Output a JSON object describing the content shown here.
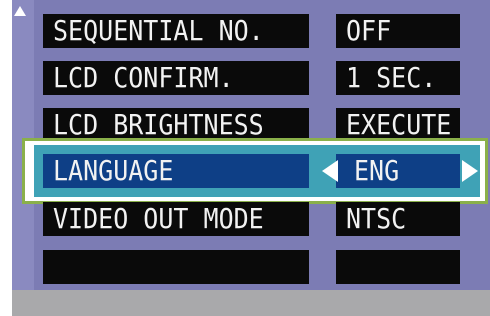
{
  "menu": {
    "rows": [
      {
        "label": "SEQUENTIAL NO.",
        "value": "OFF"
      },
      {
        "label": "LCD CONFIRM.",
        "value": "1 SEC."
      },
      {
        "label": "LCD BRIGHTNESS",
        "value": "EXECUTE"
      },
      {
        "label": "LANGUAGE",
        "value": "ENG"
      },
      {
        "label": "VIDEO OUT MODE",
        "value": "NTSC"
      },
      {
        "label": "",
        "value": ""
      }
    ],
    "selected_index": 3
  },
  "icons": {
    "scroll_up": "scroll-up-arrow-icon",
    "value_prev": "arrow-left-icon",
    "value_next": "arrow-right-icon"
  },
  "colors": {
    "screen_bg": "#7c7cb4",
    "cell_bg": "#0a0a0a",
    "selected_cell_bg": "#0e3f86",
    "selected_row_bg": "#3fa2b6",
    "highlight_frame": "#8ab04a"
  }
}
